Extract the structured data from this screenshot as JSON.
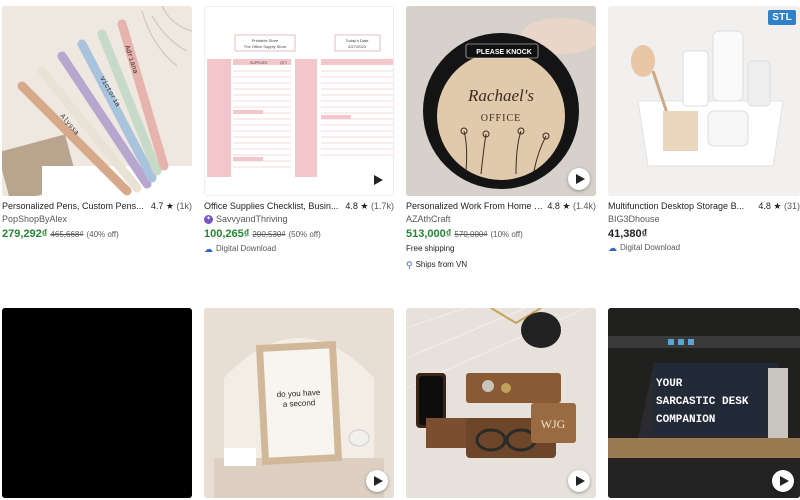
{
  "listings": [
    {
      "title": "Personalized Pens, Custom Pens...",
      "rating": "4.7",
      "review_count": "(1k)",
      "shop": "PopShopByAlex",
      "price": "279,292₫",
      "original_price": "465,668₫",
      "discount": "(40% off)",
      "has_video": false,
      "image_text": [
        "Alyssa",
        "Victoria",
        "Adriana"
      ]
    },
    {
      "title": "Office Supplies Checklist, Busin...",
      "rating": "4.8",
      "review_count": "(1.7k)",
      "shop": "SavvyandThriving",
      "price": "100,265₫",
      "original_price": "200,530₫",
      "discount": "(50% off)",
      "digital_label": "Digital Download",
      "has_video": true,
      "image_text": [
        "Printable Store",
        "The Office Supply Store",
        "Today's Date",
        "2/27/2023",
        "SUPPLIES",
        "QTY"
      ]
    },
    {
      "title": "Personalized Work From Home P...",
      "rating": "4.8",
      "review_count": "(1.4k)",
      "shop": "AZAthCraft",
      "price": "513,000₫",
      "original_price": "570,000₫",
      "discount": "(10% off)",
      "shipping": "Free shipping",
      "ships_from": "Ships from VN",
      "has_video": true,
      "image_text": [
        "PLEASE KNOCK",
        "Rachael's",
        "OFFICE"
      ]
    },
    {
      "title": "Multifunction Desktop Storage B...",
      "rating": "4.8",
      "review_count": "(31)",
      "shop": "BIG3Dhouse",
      "price": "41,380₫",
      "digital_label": "Digital Download",
      "badge": "STL",
      "has_video": false
    },
    {
      "has_video": false
    },
    {
      "has_video": true,
      "image_text": [
        "do you have",
        "a second"
      ]
    },
    {
      "has_video": true,
      "image_text": [
        "WJG"
      ]
    },
    {
      "has_video": true,
      "image_text": [
        "YOUR",
        "SARCASTIC DESK",
        "COMPANION"
      ]
    }
  ],
  "colors": {
    "sale_price": "#258635",
    "text": "#222222",
    "muted": "#595959",
    "stl_badge": "#2f80c8",
    "digital_icon": "#3366cc"
  },
  "icons": {
    "rating": "star-icon",
    "digital": "cloud-download-icon",
    "ships_from": "location-pin-icon",
    "video": "play-icon",
    "star_seller": "star-seller-badge-icon"
  }
}
